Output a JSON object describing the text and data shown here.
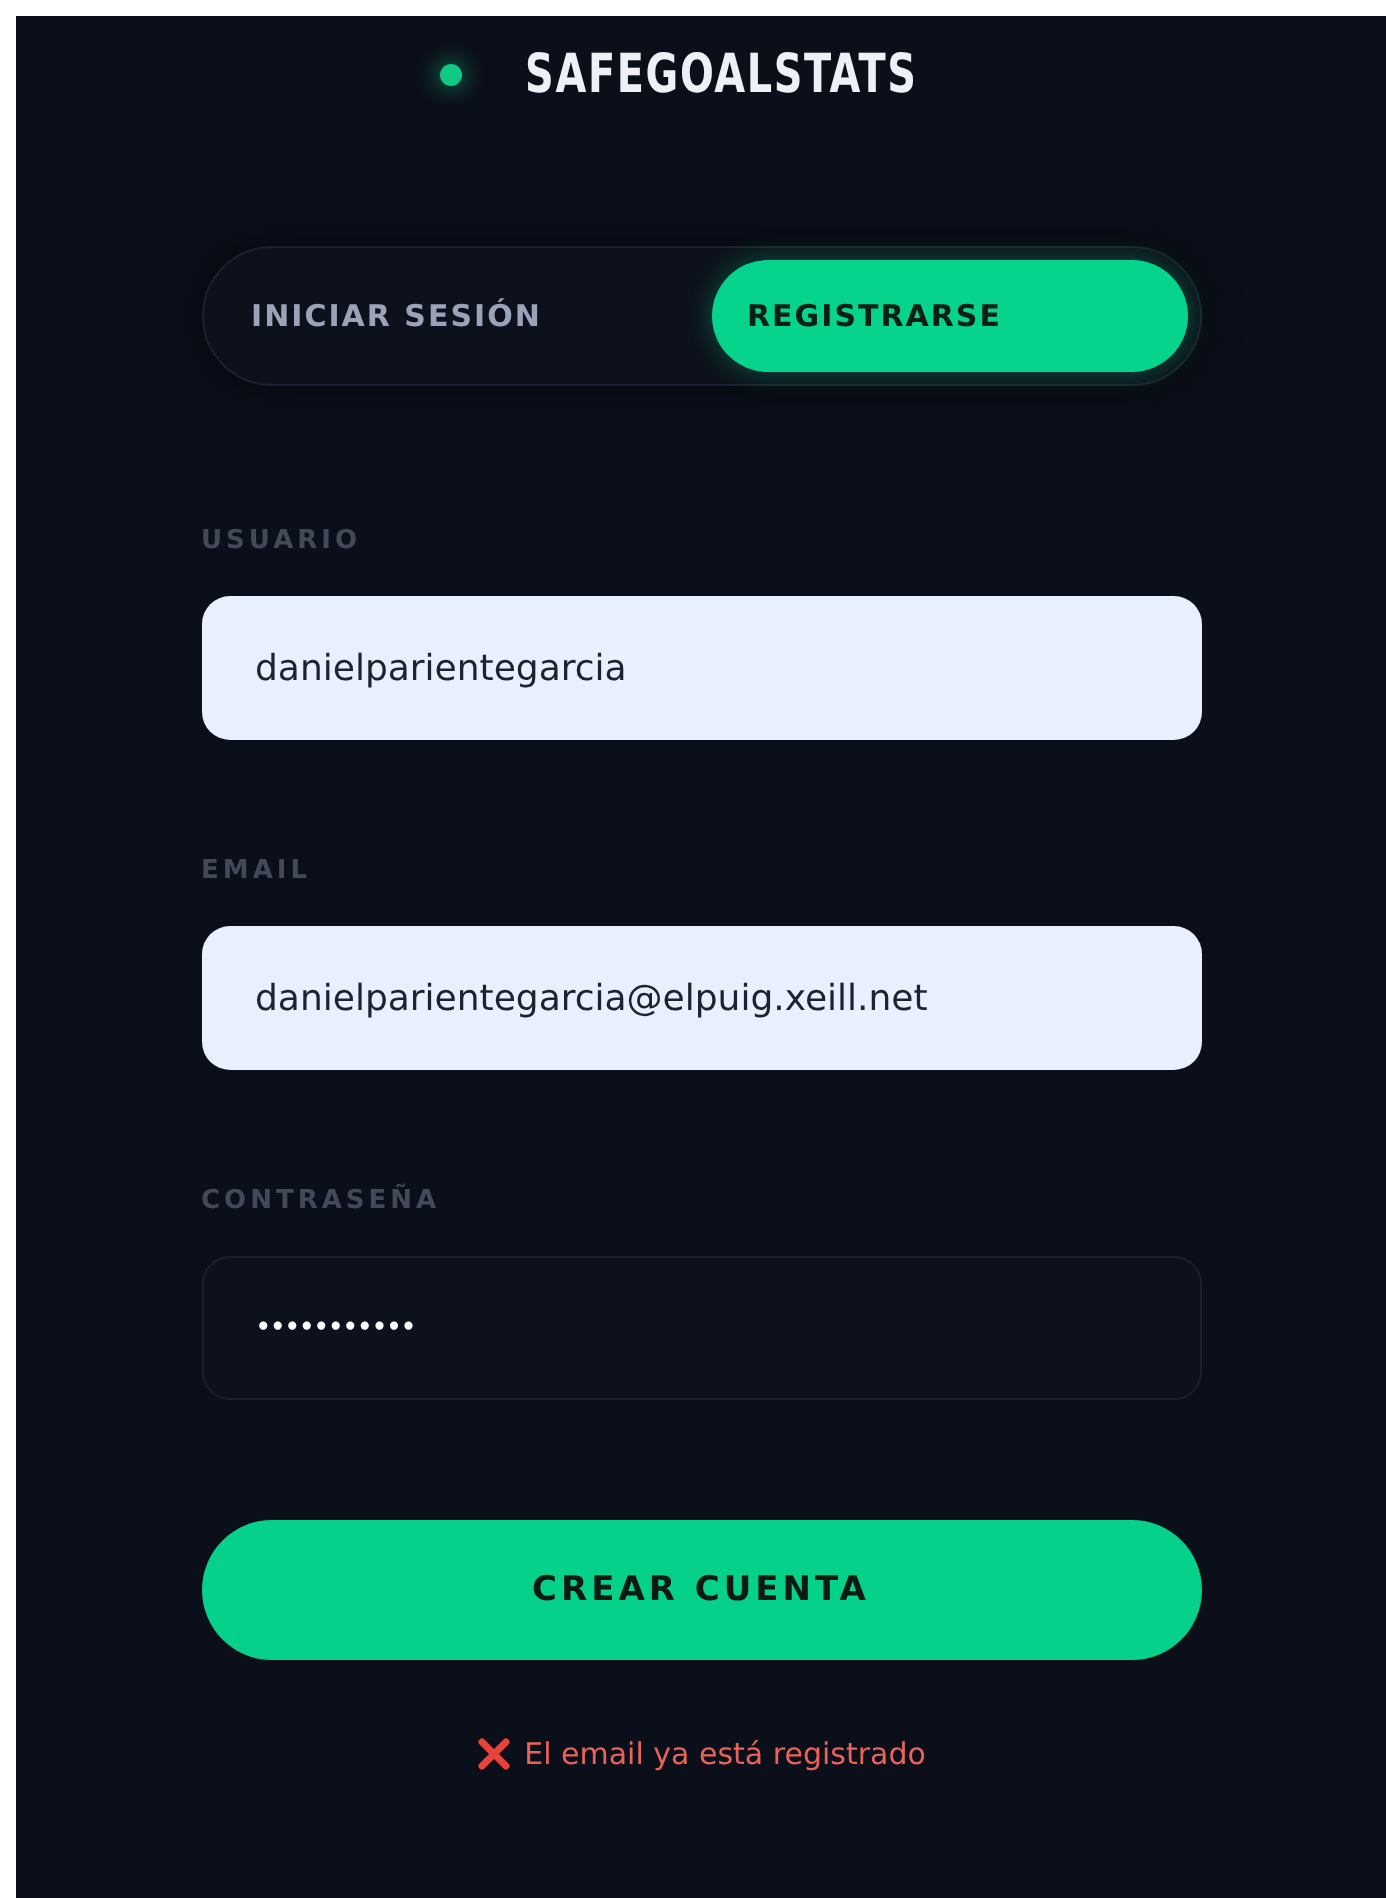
{
  "brand": {
    "name": "SAFEGOALSTATS"
  },
  "tabs": [
    {
      "label": "INICIAR SESIÓN",
      "selected": false
    },
    {
      "label": "REGISTRARSE",
      "selected": true
    }
  ],
  "fields": [
    {
      "label": "USUARIO",
      "kind": "text",
      "value": "danielparientegarcia"
    },
    {
      "label": "EMAIL",
      "kind": "text",
      "value": "danielparientegarcia@elpuig.xeill.net"
    },
    {
      "label": "CONTRASEÑA",
      "kind": "password",
      "value": "•••••••••••"
    }
  ],
  "submit_button": "CREAR CUENTA",
  "error": "El email ya está registrado"
}
